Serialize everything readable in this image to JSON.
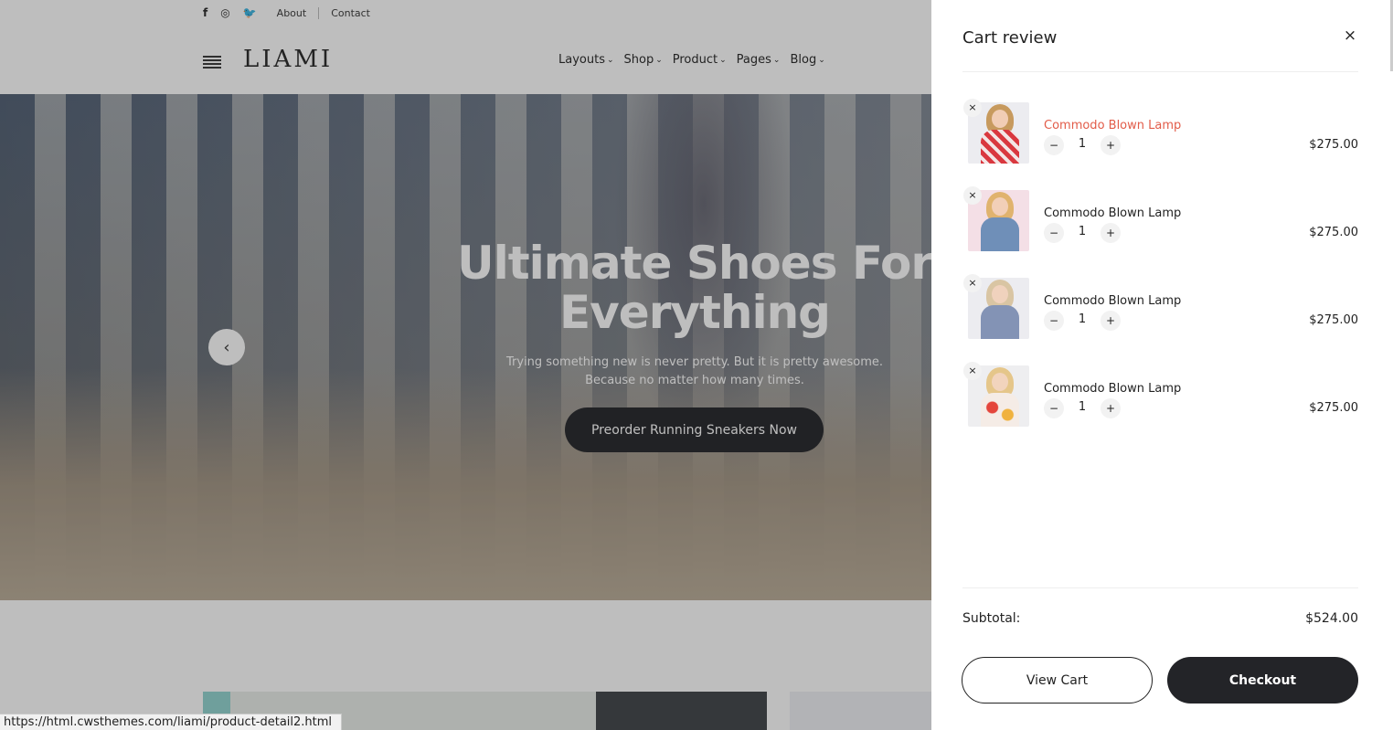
{
  "topbar": {
    "social_icons": [
      "facebook-icon",
      "instagram-icon",
      "twitter-icon"
    ],
    "social_glyphs": [
      "f",
      "◎",
      "🐦"
    ],
    "links": [
      "About",
      "Contact"
    ]
  },
  "header": {
    "logo": "LIAMI",
    "nav": [
      "Layouts",
      "Shop",
      "Product",
      "Pages",
      "Blog"
    ]
  },
  "hero": {
    "title": "Ultimate Shoes For Everything",
    "subtitle_line1": "Trying something new is never pretty. But it is pretty awesome.",
    "subtitle_line2": "Because no matter how many times.",
    "button": "Preorder Running Sneakers Now",
    "prev_arrow": "‹"
  },
  "status_bar": {
    "url": "https://html.cwsthemes.com/liami/product-detail2.html"
  },
  "cart": {
    "title": "Cart review",
    "close_glyph": "×",
    "items": [
      {
        "name": "Commodo Blown Lamp",
        "qty": "1",
        "price": "$275.00",
        "active": true
      },
      {
        "name": "Commodo Blown Lamp",
        "qty": "1",
        "price": "$275.00",
        "active": false
      },
      {
        "name": "Commodo Blown Lamp",
        "qty": "1",
        "price": "$275.00",
        "active": false
      },
      {
        "name": "Commodo Blown Lamp",
        "qty": "1",
        "price": "$275.00",
        "active": false
      }
    ],
    "remove_glyph": "×",
    "minus_glyph": "−",
    "plus_glyph": "+",
    "subtotal_label": "Subtotal:",
    "subtotal_value": "$524.00",
    "view_cart": "View Cart",
    "checkout": "Checkout"
  },
  "colors": {
    "accent": "#e25c49",
    "dark": "#232428"
  }
}
